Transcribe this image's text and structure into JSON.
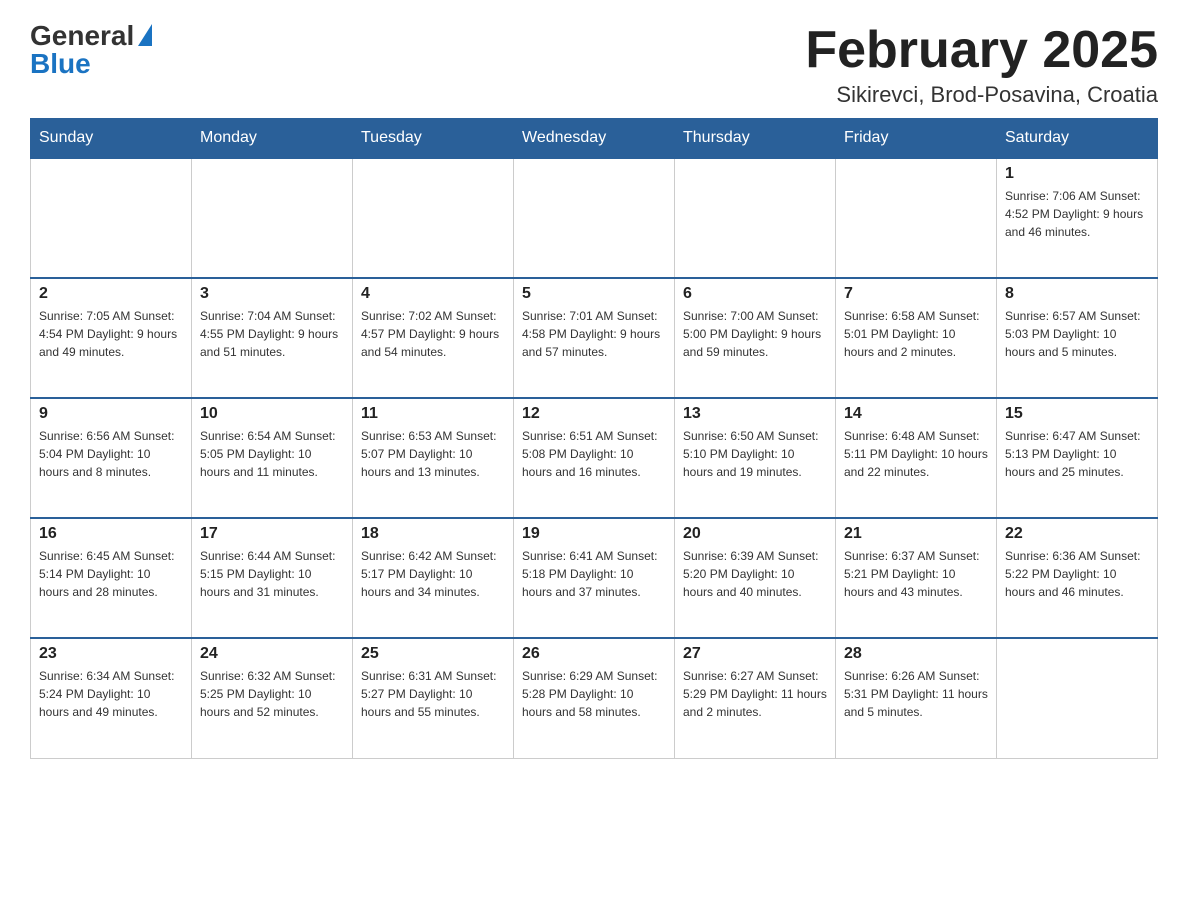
{
  "header": {
    "logo": {
      "general": "General",
      "blue": "Blue"
    },
    "title": "February 2025",
    "location": "Sikirevci, Brod-Posavina, Croatia"
  },
  "days_of_week": [
    "Sunday",
    "Monday",
    "Tuesday",
    "Wednesday",
    "Thursday",
    "Friday",
    "Saturday"
  ],
  "weeks": [
    [
      {
        "day": "",
        "info": ""
      },
      {
        "day": "",
        "info": ""
      },
      {
        "day": "",
        "info": ""
      },
      {
        "day": "",
        "info": ""
      },
      {
        "day": "",
        "info": ""
      },
      {
        "day": "",
        "info": ""
      },
      {
        "day": "1",
        "info": "Sunrise: 7:06 AM\nSunset: 4:52 PM\nDaylight: 9 hours and 46 minutes."
      }
    ],
    [
      {
        "day": "2",
        "info": "Sunrise: 7:05 AM\nSunset: 4:54 PM\nDaylight: 9 hours and 49 minutes."
      },
      {
        "day": "3",
        "info": "Sunrise: 7:04 AM\nSunset: 4:55 PM\nDaylight: 9 hours and 51 minutes."
      },
      {
        "day": "4",
        "info": "Sunrise: 7:02 AM\nSunset: 4:57 PM\nDaylight: 9 hours and 54 minutes."
      },
      {
        "day": "5",
        "info": "Sunrise: 7:01 AM\nSunset: 4:58 PM\nDaylight: 9 hours and 57 minutes."
      },
      {
        "day": "6",
        "info": "Sunrise: 7:00 AM\nSunset: 5:00 PM\nDaylight: 9 hours and 59 minutes."
      },
      {
        "day": "7",
        "info": "Sunrise: 6:58 AM\nSunset: 5:01 PM\nDaylight: 10 hours and 2 minutes."
      },
      {
        "day": "8",
        "info": "Sunrise: 6:57 AM\nSunset: 5:03 PM\nDaylight: 10 hours and 5 minutes."
      }
    ],
    [
      {
        "day": "9",
        "info": "Sunrise: 6:56 AM\nSunset: 5:04 PM\nDaylight: 10 hours and 8 minutes."
      },
      {
        "day": "10",
        "info": "Sunrise: 6:54 AM\nSunset: 5:05 PM\nDaylight: 10 hours and 11 minutes."
      },
      {
        "day": "11",
        "info": "Sunrise: 6:53 AM\nSunset: 5:07 PM\nDaylight: 10 hours and 13 minutes."
      },
      {
        "day": "12",
        "info": "Sunrise: 6:51 AM\nSunset: 5:08 PM\nDaylight: 10 hours and 16 minutes."
      },
      {
        "day": "13",
        "info": "Sunrise: 6:50 AM\nSunset: 5:10 PM\nDaylight: 10 hours and 19 minutes."
      },
      {
        "day": "14",
        "info": "Sunrise: 6:48 AM\nSunset: 5:11 PM\nDaylight: 10 hours and 22 minutes."
      },
      {
        "day": "15",
        "info": "Sunrise: 6:47 AM\nSunset: 5:13 PM\nDaylight: 10 hours and 25 minutes."
      }
    ],
    [
      {
        "day": "16",
        "info": "Sunrise: 6:45 AM\nSunset: 5:14 PM\nDaylight: 10 hours and 28 minutes."
      },
      {
        "day": "17",
        "info": "Sunrise: 6:44 AM\nSunset: 5:15 PM\nDaylight: 10 hours and 31 minutes."
      },
      {
        "day": "18",
        "info": "Sunrise: 6:42 AM\nSunset: 5:17 PM\nDaylight: 10 hours and 34 minutes."
      },
      {
        "day": "19",
        "info": "Sunrise: 6:41 AM\nSunset: 5:18 PM\nDaylight: 10 hours and 37 minutes."
      },
      {
        "day": "20",
        "info": "Sunrise: 6:39 AM\nSunset: 5:20 PM\nDaylight: 10 hours and 40 minutes."
      },
      {
        "day": "21",
        "info": "Sunrise: 6:37 AM\nSunset: 5:21 PM\nDaylight: 10 hours and 43 minutes."
      },
      {
        "day": "22",
        "info": "Sunrise: 6:36 AM\nSunset: 5:22 PM\nDaylight: 10 hours and 46 minutes."
      }
    ],
    [
      {
        "day": "23",
        "info": "Sunrise: 6:34 AM\nSunset: 5:24 PM\nDaylight: 10 hours and 49 minutes."
      },
      {
        "day": "24",
        "info": "Sunrise: 6:32 AM\nSunset: 5:25 PM\nDaylight: 10 hours and 52 minutes."
      },
      {
        "day": "25",
        "info": "Sunrise: 6:31 AM\nSunset: 5:27 PM\nDaylight: 10 hours and 55 minutes."
      },
      {
        "day": "26",
        "info": "Sunrise: 6:29 AM\nSunset: 5:28 PM\nDaylight: 10 hours and 58 minutes."
      },
      {
        "day": "27",
        "info": "Sunrise: 6:27 AM\nSunset: 5:29 PM\nDaylight: 11 hours and 2 minutes."
      },
      {
        "day": "28",
        "info": "Sunrise: 6:26 AM\nSunset: 5:31 PM\nDaylight: 11 hours and 5 minutes."
      },
      {
        "day": "",
        "info": ""
      }
    ]
  ]
}
